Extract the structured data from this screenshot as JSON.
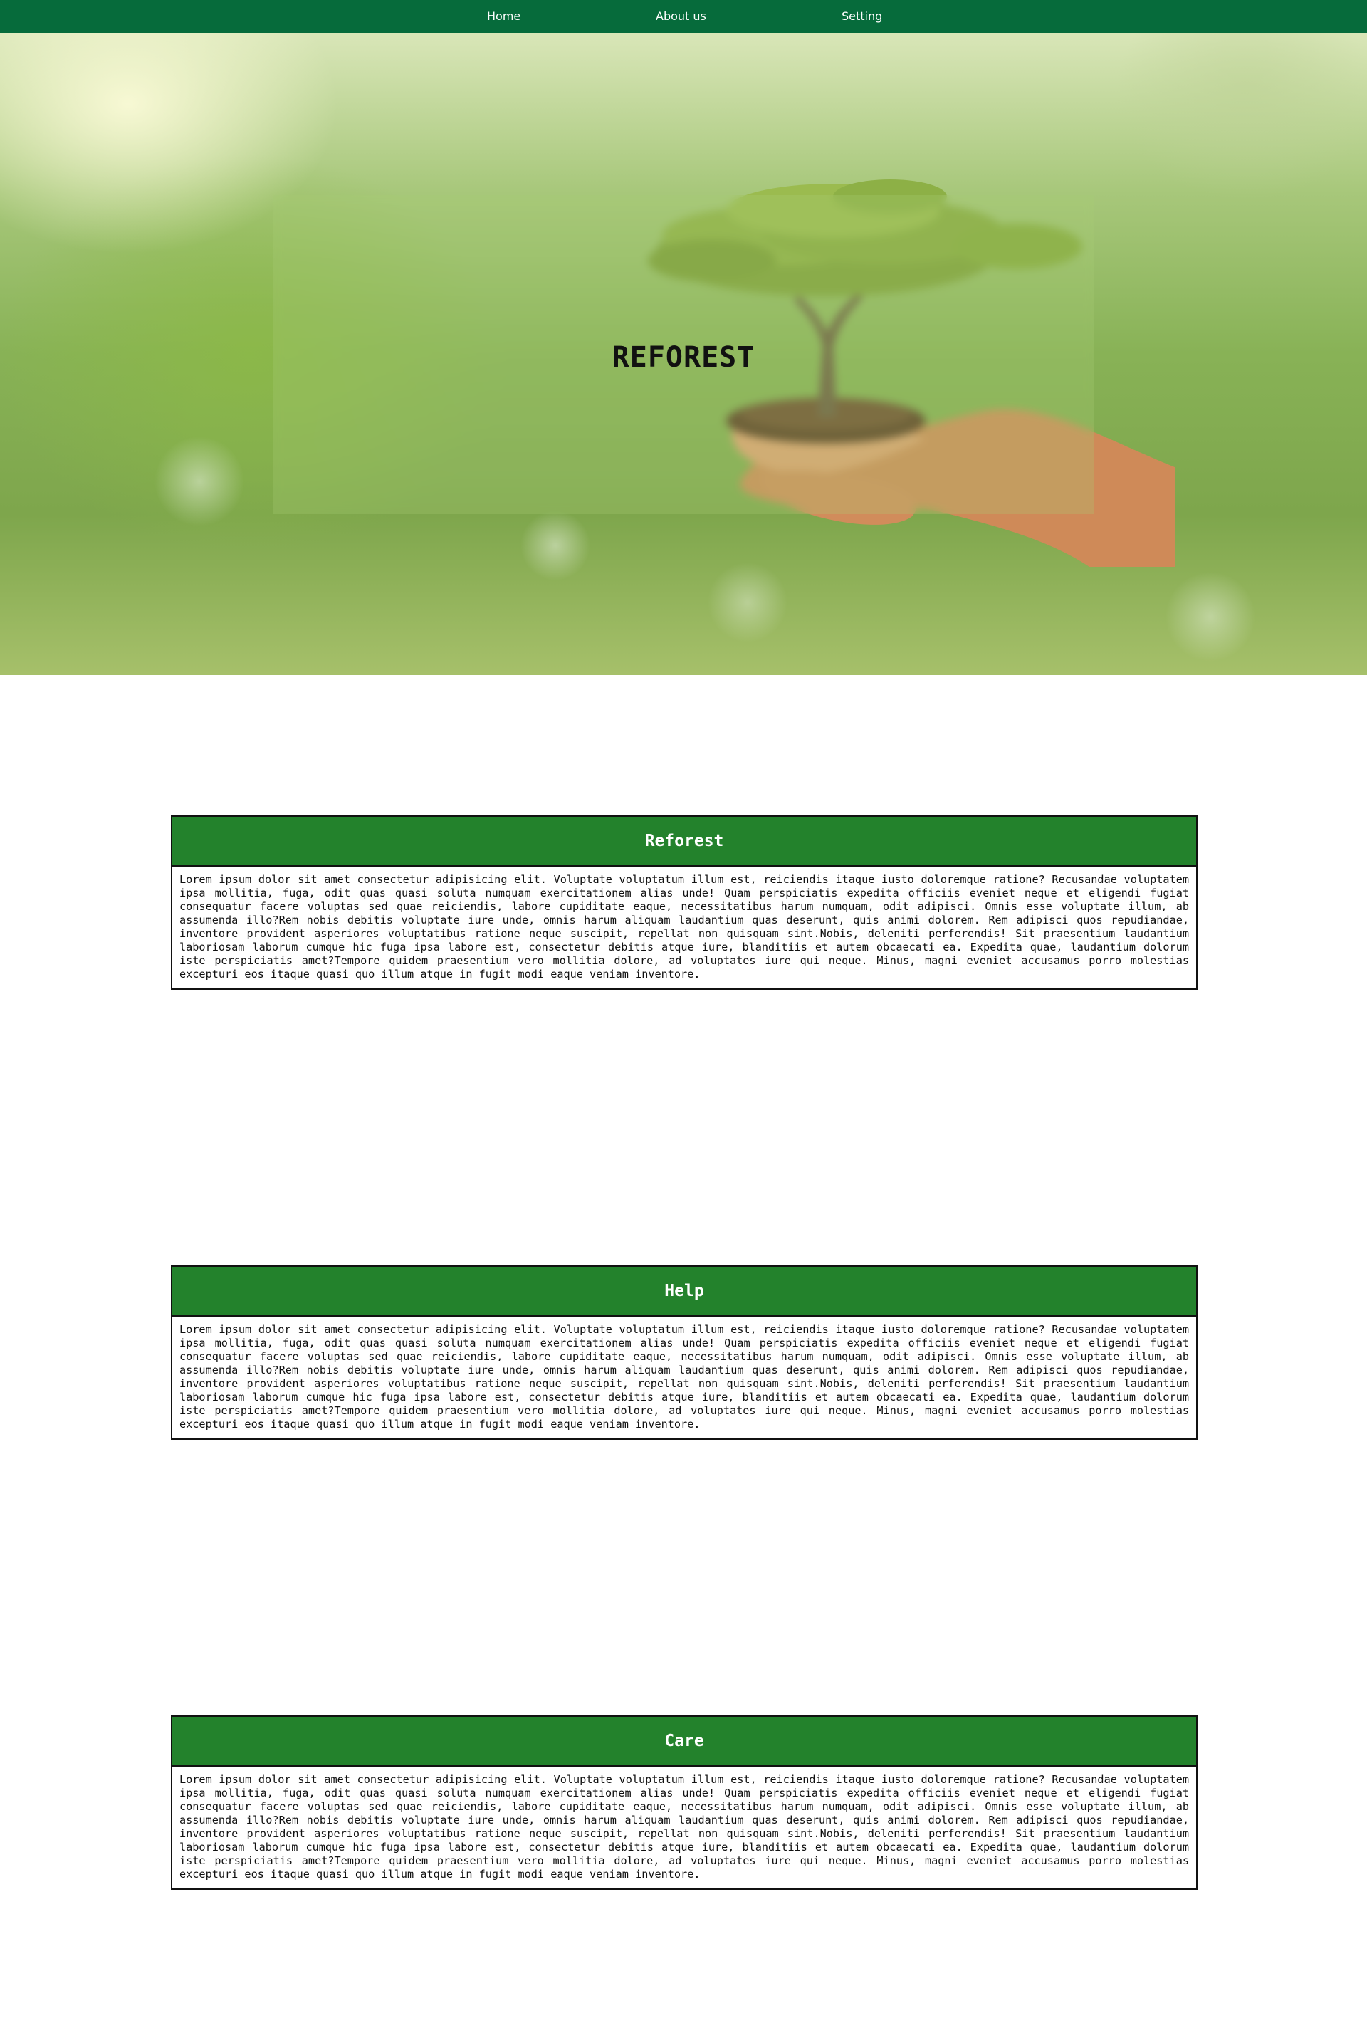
{
  "nav": {
    "items": [
      {
        "label": "Home"
      },
      {
        "label": "About us"
      },
      {
        "label": "Setting"
      }
    ]
  },
  "hero": {
    "title": "REFOREST"
  },
  "sections": [
    {
      "title": "Reforest",
      "body": "Lorem ipsum dolor sit amet consectetur adipisicing elit. Voluptate voluptatum illum est, reiciendis itaque iusto doloremque ratione? Recusandae voluptatem ipsa mollitia, fuga, odit quas quasi soluta numquam exercitationem alias unde! Quam perspiciatis expedita officiis eveniet neque et eligendi fugiat consequatur facere voluptas sed quae reiciendis, labore cupiditate eaque, necessitatibus harum numquam, odit adipisci. Omnis esse voluptate illum, ab assumenda illo?Rem nobis debitis voluptate iure unde, omnis harum aliquam laudantium quas deserunt, quis animi dolorem. Rem adipisci quos repudiandae, inventore provident asperiores voluptatibus ratione neque suscipit, repellat non quisquam sint.Nobis, deleniti perferendis! Sit praesentium laudantium laboriosam laborum cumque hic fuga ipsa labore est, consectetur debitis atque iure, blanditiis et autem obcaecati ea. Expedita quae, laudantium dolorum iste perspiciatis amet?Tempore quidem praesentium vero mollitia dolore, ad voluptates iure qui neque. Minus, magni eveniet accusamus porro molestias excepturi eos itaque quasi quo illum atque in fugit modi eaque veniam inventore."
    },
    {
      "title": "Help",
      "body": "Lorem ipsum dolor sit amet consectetur adipisicing elit. Voluptate voluptatum illum est, reiciendis itaque iusto doloremque ratione? Recusandae voluptatem ipsa mollitia, fuga, odit quas quasi soluta numquam exercitationem alias unde! Quam perspiciatis expedita officiis eveniet neque et eligendi fugiat consequatur facere voluptas sed quae reiciendis, labore cupiditate eaque, necessitatibus harum numquam, odit adipisci. Omnis esse voluptate illum, ab assumenda illo?Rem nobis debitis voluptate iure unde, omnis harum aliquam laudantium quas deserunt, quis animi dolorem. Rem adipisci quos repudiandae, inventore provident asperiores voluptatibus ratione neque suscipit, repellat non quisquam sint.Nobis, deleniti perferendis! Sit praesentium laudantium laboriosam laborum cumque hic fuga ipsa labore est, consectetur debitis atque iure, blanditiis et autem obcaecati ea. Expedita quae, laudantium dolorum iste perspiciatis amet?Tempore quidem praesentium vero mollitia dolore, ad voluptates iure qui neque. Minus, magni eveniet accusamus porro molestias excepturi eos itaque quasi quo illum atque in fugit modi eaque veniam inventore."
    },
    {
      "title": "Care",
      "body": "Lorem ipsum dolor sit amet consectetur adipisicing elit. Voluptate voluptatum illum est, reiciendis itaque iusto doloremque ratione? Recusandae voluptatem ipsa mollitia, fuga, odit quas quasi soluta numquam exercitationem alias unde! Quam perspiciatis expedita officiis eveniet neque et eligendi fugiat consequatur facere voluptas sed quae reiciendis, labore cupiditate eaque, necessitatibus harum numquam, odit adipisci. Omnis esse voluptate illum, ab assumenda illo?Rem nobis debitis voluptate iure unde, omnis harum aliquam laudantium quas deserunt, quis animi dolorem. Rem adipisci quos repudiandae, inventore provident asperiores voluptatibus ratione neque suscipit, repellat non quisquam sint.Nobis, deleniti perferendis! Sit praesentium laudantium laboriosam laborum cumque hic fuga ipsa labore est, consectetur debitis atque iure, blanditiis et autem obcaecati ea. Expedita quae, laudantium dolorum iste perspiciatis amet?Tempore quidem praesentium vero mollitia dolore, ad voluptates iure qui neque. Minus, magni eveniet accusamus porro molestias excepturi eos itaque quasi quo illum atque in fugit modi eaque veniam inventore."
    }
  ],
  "colors": {
    "nav_bg": "#066b3b",
    "section_header_bg": "#23822c",
    "border": "#111111"
  },
  "images": {
    "hero_background": "tree-in-hands-photo"
  }
}
